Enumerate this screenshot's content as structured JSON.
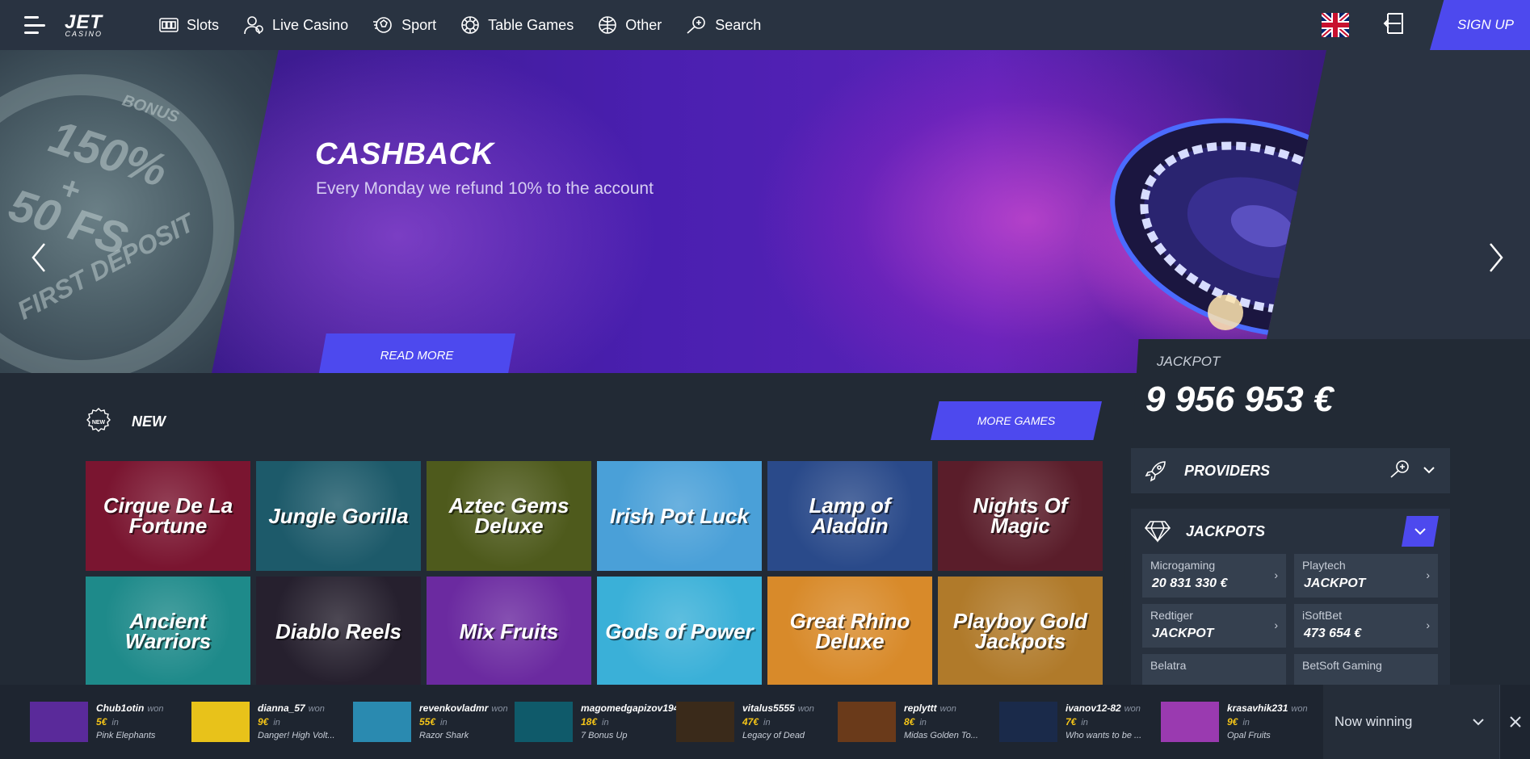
{
  "logo": {
    "name": "JET",
    "sub": "CASINO"
  },
  "nav": [
    {
      "label": "Slots",
      "icon": "slot-machine-icon"
    },
    {
      "label": "Live Casino",
      "icon": "dealer-icon"
    },
    {
      "label": "Sport",
      "icon": "soccer-ball-icon"
    },
    {
      "label": "Table Games",
      "icon": "chip-icon"
    },
    {
      "label": "Other",
      "icon": "ball-icon"
    },
    {
      "label": "Search",
      "icon": "search-plus-icon"
    }
  ],
  "header": {
    "signup_label": "SIGN UP",
    "language": "English (UK flag)"
  },
  "banner": {
    "title": "CASHBACK",
    "subtitle": "Every Monday we refund 10% to the account",
    "cta": "READ MORE",
    "side_promo": {
      "line1": "BONUS",
      "line2": "150%",
      "line3": "+",
      "line4": "50 FS",
      "line5": "FIRST DEPOSIT"
    }
  },
  "jackpot": {
    "label": "JACKPOT",
    "amount": "9 956 953 €",
    "providers_label": "PROVIDERS",
    "jackpots_label": "JACKPOTS",
    "items": [
      {
        "provider": "Microgaming",
        "value": "20 831 330 €"
      },
      {
        "provider": "Playtech",
        "value": "JACKPOT"
      },
      {
        "provider": "Redtiger",
        "value": "JACKPOT"
      },
      {
        "provider": "iSoftBet",
        "value": "473 654 €"
      },
      {
        "provider": "Belatra",
        "value": ""
      },
      {
        "provider": "BetSoft Gaming",
        "value": ""
      }
    ]
  },
  "new_section": {
    "title": "NEW",
    "badge": "NEW",
    "more_label": "MORE GAMES",
    "games": [
      {
        "title": "Cirque De La Fortune",
        "bg": "#7a1530"
      },
      {
        "title": "Jungle Gorilla",
        "bg": "#1d5a6a"
      },
      {
        "title": "Aztec Gems Deluxe",
        "bg": "#4e5a1c"
      },
      {
        "title": "Irish Pot Luck",
        "bg": "#4aa0d8"
      },
      {
        "title": "Lamp of Aladdin",
        "bg": "#2a4a8a"
      },
      {
        "title": "Nights Of Magic",
        "bg": "#5a1d2a"
      },
      {
        "title": "Ancient Warriors",
        "bg": "#1e8a8a"
      },
      {
        "title": "Diablo Reels",
        "bg": "#26202e"
      },
      {
        "title": "Mix Fruits",
        "bg": "#6b2aa0"
      },
      {
        "title": "Gods of Power",
        "bg": "#3ab0d8"
      },
      {
        "title": "Great Rhino Deluxe",
        "bg": "#d88a2a"
      },
      {
        "title": "Playboy Gold Jackpots",
        "bg": "#b07a2a"
      }
    ]
  },
  "ticker": {
    "won_label": "won",
    "in_label": "in",
    "now_winning": "Now winning",
    "winners": [
      {
        "user": "Chub1otin",
        "amount": "5€",
        "game": "Pink Elephants",
        "bg": "#5a2a9a"
      },
      {
        "user": "dianna_57",
        "amount": "9€",
        "game": "Danger! High Volt...",
        "bg": "#e8c21a"
      },
      {
        "user": "revenkovladmr",
        "amount": "55€",
        "game": "Razor Shark",
        "bg": "#2a8ab0"
      },
      {
        "user": "magomedgapizov194",
        "amount": "18€",
        "game": "7 Bonus Up",
        "bg": "#0f5a6a"
      },
      {
        "user": "vitalus5555",
        "amount": "47€",
        "game": "Legacy of Dead",
        "bg": "#3a2a1a"
      },
      {
        "user": "replyttt",
        "amount": "8€",
        "game": "Midas Golden To...",
        "bg": "#6a3a1a"
      },
      {
        "user": "ivanov12-82",
        "amount": "7€",
        "game": "Who wants to be ...",
        "bg": "#1a2a4a"
      },
      {
        "user": "krasavhik231",
        "amount": "9€",
        "game": "Opal Fruits",
        "bg": "#9a3ab0"
      }
    ]
  },
  "colors": {
    "accent": "#4d49ee",
    "bg": "#222a35",
    "header": "#293341",
    "gold": "#f5c518"
  }
}
